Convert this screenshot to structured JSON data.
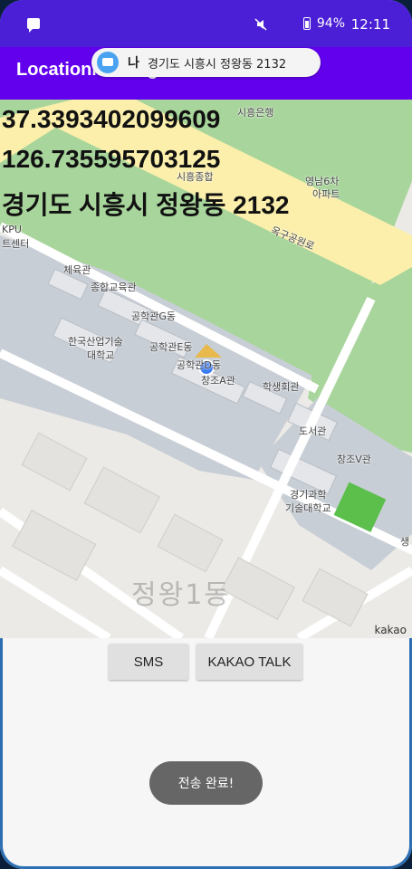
{
  "statusbar": {
    "battery": "94%",
    "time": "12:11"
  },
  "app": {
    "title": "LocationMessage"
  },
  "notification": {
    "sender": "나",
    "text": "경기도 시흥시 정왕동 2132"
  },
  "location": {
    "latitude": "37.3393402099609",
    "longitude": "126.735595703125",
    "address": "경기도 시흥시 정왕동 2132"
  },
  "map": {
    "logo": "kakao",
    "area_label": "정왕1동",
    "labels": [
      "시흥종합",
      "시흥은행",
      "영남6차",
      "아파트",
      "옥구공원로",
      "KPU",
      "트센터",
      "체육관",
      "종합교육관",
      "공학관G동",
      "한국산업기술",
      "대학교",
      "공학관E동",
      "공학관D동",
      "창조A관",
      "학생회관",
      "도서관",
      "창조V관",
      "경기과학",
      "기술대학교",
      "생"
    ]
  },
  "buttons": {
    "sms": "SMS",
    "kakao": "KAKAO TALK"
  },
  "toast": {
    "text": "전송 완료!"
  }
}
